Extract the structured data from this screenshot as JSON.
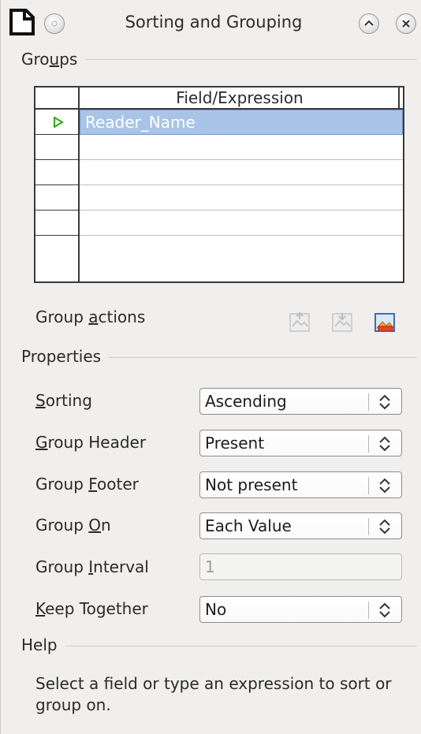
{
  "window": {
    "title": "Sorting and Grouping"
  },
  "groups": {
    "label_pre": "Gro",
    "label_mnemonic": "u",
    "label_post": "ps",
    "column_header": "Field/Expression",
    "rows": [
      "Reader_Name",
      "",
      "",
      "",
      "",
      ""
    ]
  },
  "group_actions": {
    "label_pre": "Group ",
    "label_mnemonic": "a",
    "label_post": "ctions",
    "buttons": [
      "move-up-icon",
      "move-down-icon",
      "delete-icon"
    ]
  },
  "properties": {
    "label": "Properties",
    "sorting": {
      "pre": "",
      "mn": "S",
      "post": "orting",
      "value": "Ascending"
    },
    "group_header": {
      "pre": "",
      "mn": "G",
      "post": "roup Header",
      "value": "Present"
    },
    "group_footer": {
      "pre": "Group ",
      "mn": "F",
      "post": "ooter",
      "value": "Not present"
    },
    "group_on": {
      "pre": "Group ",
      "mn": "O",
      "post": "n",
      "value": "Each Value"
    },
    "group_interval": {
      "pre": "Group ",
      "mn": "I",
      "post": "nterval",
      "value": "1"
    },
    "keep_together": {
      "pre": "",
      "mn": "K",
      "post": "eep Together",
      "value": "No"
    }
  },
  "help": {
    "label": "Help",
    "text": "Select a field or type an expression to sort or group on."
  },
  "colors": {
    "selection": "#a9c4e6",
    "accent_arrow": "#34a615",
    "window_bg": "#f0efee"
  }
}
